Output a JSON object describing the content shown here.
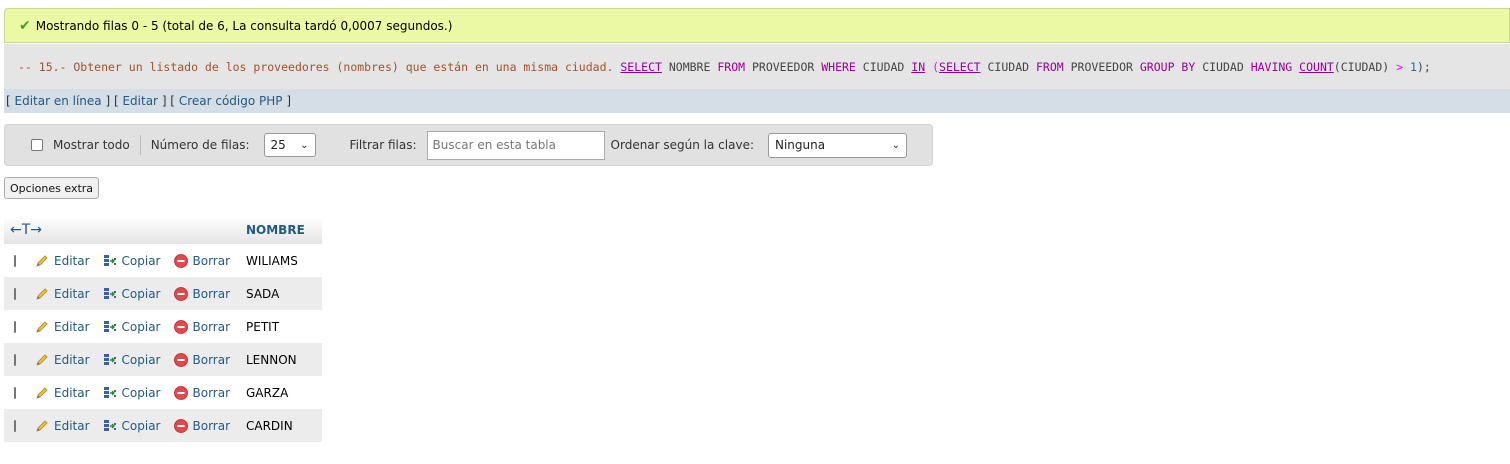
{
  "message": {
    "icon": "check-icon",
    "text": "Mostrando filas 0 - 5 (total de 6, La consulta tardó 0,0007 segundos.)"
  },
  "sql": {
    "comment": "-- 15.- Obtener un listado de los proveedores (nombres) que están en una misma ciudad.",
    "select1": "SELECT",
    "col1": "NOMBRE",
    "from1": "FROM",
    "table1": "PROVEEDOR",
    "where": "WHERE",
    "col2": "CIUDAD",
    "in": "IN",
    "paren_open": "(",
    "select2": "SELECT",
    "col3": "CIUDAD",
    "from2": "FROM",
    "table2": "PROVEEDOR",
    "group_by": "GROUP BY",
    "col4": "CIUDAD",
    "having": "HAVING",
    "count": "COUNT",
    "count_arg": "(CIUDAD)",
    "gt": ">",
    "num": "1",
    "tail": ");"
  },
  "edit_links": {
    "inline": "Editar en línea",
    "edit": "Editar",
    "php": "Crear código PHP"
  },
  "navbar": {
    "show_all": "Mostrar todo",
    "rows_label": "Número de filas:",
    "rows_value": "25",
    "filter_label": "Filtrar filas:",
    "filter_placeholder": "Buscar en esta tabla",
    "sort_label": "Ordenar según la clave:",
    "sort_value": "Ninguna"
  },
  "extra_options": "Opciones extra",
  "table": {
    "arrows": "←T→",
    "column": "NOMBRE",
    "actions": {
      "edit": "Editar",
      "copy": "Copiar",
      "delete": "Borrar"
    },
    "rows": [
      "WILIAMS",
      "SADA",
      "PETIT",
      "LENNON",
      "GARZA",
      "CARDIN"
    ]
  }
}
